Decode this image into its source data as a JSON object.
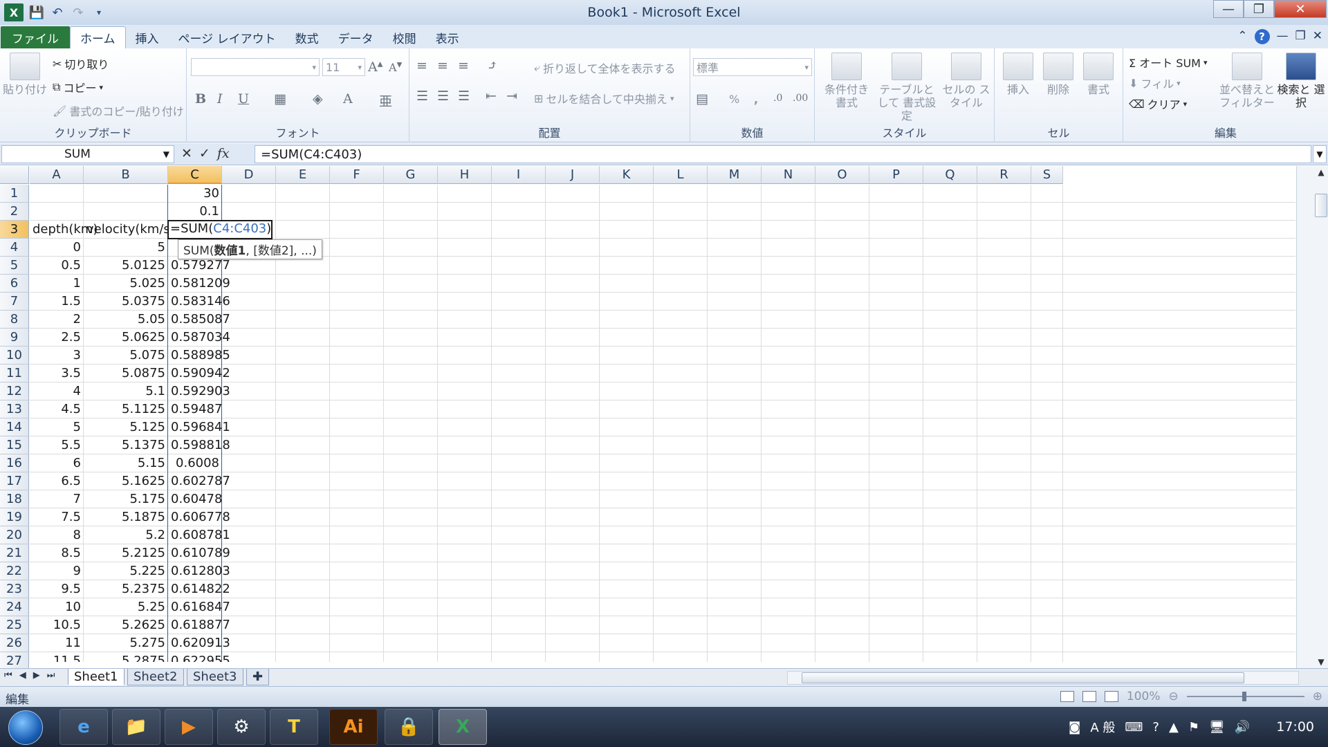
{
  "window": {
    "title": "Book1 - Microsoft Excel",
    "minimize": "—",
    "restore": "❐",
    "close": "✕"
  },
  "tabs": [
    "ファイル",
    "ホーム",
    "挿入",
    "ページ レイアウト",
    "数式",
    "データ",
    "校閲",
    "表示"
  ],
  "ribbon": {
    "clipboard": {
      "paste": "貼り付け",
      "cut": "切り取り",
      "copy": "コピー",
      "format_painter": "書式のコピー/貼り付け",
      "label": "クリップボード"
    },
    "font": {
      "font_name": "",
      "font_size": "11",
      "label": "フォント"
    },
    "alignment": {
      "wrap_text": "折り返して全体を表示する",
      "merge_center": "セルを結合して中央揃え",
      "label": "配置"
    },
    "number": {
      "format": "標準",
      "percent": "%",
      "comma": ",",
      "label": "数値"
    },
    "styles": {
      "conditional": "条件付き 書式",
      "table": "テーブルとして 書式設定",
      "cell_styles": "セルの スタイル",
      "label": "スタイル"
    },
    "cells": {
      "insert": "挿入",
      "delete": "削除",
      "format": "書式",
      "label": "セル"
    },
    "editing": {
      "autosum": "Σ オート SUM",
      "fill": "フィル",
      "clear": "クリア",
      "sort_filter": "並べ替えと フィルター",
      "find_select": "検索と 選択",
      "label": "編集"
    }
  },
  "formula_bar": {
    "name_box": "SUM",
    "cancel": "✕",
    "enter": "✓",
    "fx": "fx",
    "formula": "=SUM(C4:C403)"
  },
  "columns": [
    "A",
    "B",
    "C",
    "D",
    "E",
    "F",
    "G",
    "H",
    "I",
    "J",
    "K",
    "L",
    "M",
    "N",
    "O",
    "P",
    "Q",
    "R",
    "S"
  ],
  "rows": [
    "1",
    "2",
    "3",
    "4",
    "5",
    "6",
    "7",
    "8",
    "9",
    "10",
    "11",
    "12",
    "13",
    "14",
    "15",
    "16",
    "17",
    "18",
    "19",
    "20",
    "21",
    "22",
    "23",
    "24",
    "25",
    "26",
    "27"
  ],
  "sheet": {
    "c1": "30",
    "c2": "0.1",
    "a3": "depth(km)",
    "b3": "velocity(km/s)",
    "active_prefix": "=SUM(",
    "active_ref": "C4:C403",
    "active_suffix": ")",
    "tooltip_fn": "SUM(",
    "tooltip_arg1": "数値1",
    "tooltip_rest": ", [数値2], ...)",
    "data": [
      [
        "0",
        "5",
        ""
      ],
      [
        "0.5",
        "5.0125",
        "0.579277"
      ],
      [
        "1",
        "5.025",
        "0.581209"
      ],
      [
        "1.5",
        "5.0375",
        "0.583146"
      ],
      [
        "2",
        "5.05",
        "0.585087"
      ],
      [
        "2.5",
        "5.0625",
        "0.587034"
      ],
      [
        "3",
        "5.075",
        "0.588985"
      ],
      [
        "3.5",
        "5.0875",
        "0.590942"
      ],
      [
        "4",
        "5.1",
        "0.592903"
      ],
      [
        "4.5",
        "5.1125",
        "0.59487"
      ],
      [
        "5",
        "5.125",
        "0.596841"
      ],
      [
        "5.5",
        "5.1375",
        "0.598818"
      ],
      [
        "6",
        "5.15",
        "0.6008"
      ],
      [
        "6.5",
        "5.1625",
        "0.602787"
      ],
      [
        "7",
        "5.175",
        "0.60478"
      ],
      [
        "7.5",
        "5.1875",
        "0.606778"
      ],
      [
        "8",
        "5.2",
        "0.608781"
      ],
      [
        "8.5",
        "5.2125",
        "0.610789"
      ],
      [
        "9",
        "5.225",
        "0.612803"
      ],
      [
        "9.5",
        "5.2375",
        "0.614822"
      ],
      [
        "10",
        "5.25",
        "0.616847"
      ],
      [
        "10.5",
        "5.2625",
        "0.618877"
      ],
      [
        "11",
        "5.275",
        "0.620913"
      ],
      [
        "11.5",
        "5.2875",
        "0.622955"
      ]
    ]
  },
  "sheet_tabs": [
    "Sheet1",
    "Sheet2",
    "Sheet3"
  ],
  "status": {
    "mode": "編集",
    "zoom": "100%"
  },
  "taskbar": {
    "apps": [
      "e",
      "📁",
      "▶",
      "⚙",
      "T",
      "Ai",
      "🔒",
      "X"
    ],
    "tray_ime": "A 般",
    "clock": "17:00"
  },
  "colors": {
    "excel_green": "#1e7145",
    "select_orange": "#f1c15f",
    "ref_blue": "#3a6fbd"
  }
}
